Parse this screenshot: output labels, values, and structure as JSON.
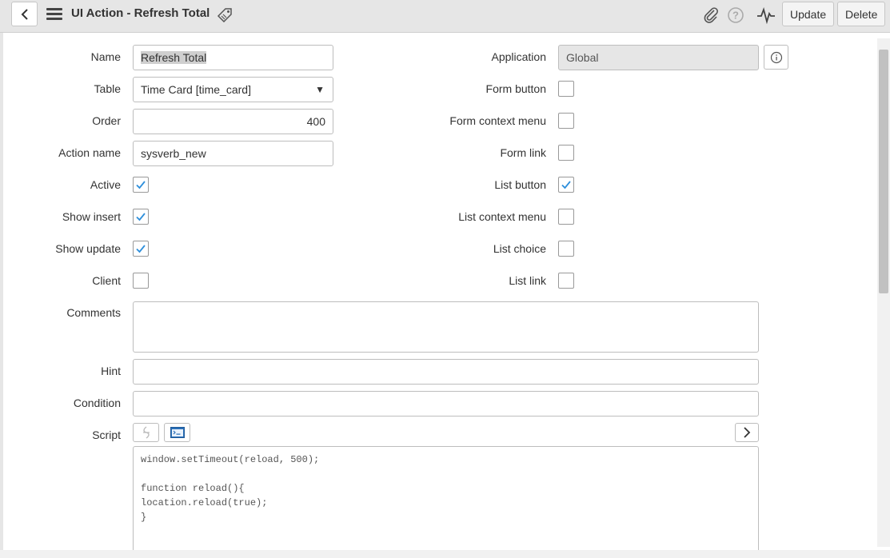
{
  "header": {
    "title": "UI Action - Refresh Total",
    "update_label": "Update",
    "delete_label": "Delete"
  },
  "form": {
    "left": {
      "name_label": "Name",
      "name_value": "Refresh Total",
      "table_label": "Table",
      "table_value": "Time Card [time_card]",
      "order_label": "Order",
      "order_value": "400",
      "action_name_label": "Action name",
      "action_name_value": "sysverb_new",
      "active_label": "Active",
      "show_insert_label": "Show insert",
      "show_update_label": "Show update",
      "client_label": "Client"
    },
    "right": {
      "application_label": "Application",
      "application_value": "Global",
      "form_button_label": "Form button",
      "form_context_menu_label": "Form context menu",
      "form_link_label": "Form link",
      "list_button_label": "List button",
      "list_context_menu_label": "List context menu",
      "list_choice_label": "List choice",
      "list_link_label": "List link"
    },
    "checkboxes": {
      "active": true,
      "show_insert": true,
      "show_update": true,
      "client": false,
      "form_button": false,
      "form_context_menu": false,
      "form_link": false,
      "list_button": true,
      "list_context_menu": false,
      "list_choice": false,
      "list_link": false
    },
    "comments_label": "Comments",
    "hint_label": "Hint",
    "condition_label": "Condition",
    "script_label": "Script",
    "script_code": "window.setTimeout(reload, 500);\n\nfunction reload(){\nlocation.reload(true);\n}"
  },
  "colors": {
    "check": "#2e8fdb",
    "header_bg": "#e6e6e6"
  }
}
